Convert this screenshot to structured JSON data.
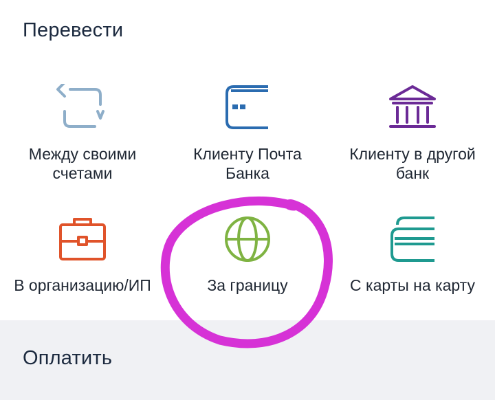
{
  "transfer": {
    "title": "Перевести",
    "items": [
      {
        "label": "Между своими\nсчетами",
        "icon": "arrows-cycle-icon",
        "color": "#8eaec9"
      },
      {
        "label": "Клиенту Почта\nБанка",
        "icon": "card-icon",
        "color": "#2b6cb0"
      },
      {
        "label": "Клиенту в другой\nбанк",
        "icon": "bank-building-icon",
        "color": "#6b2a96"
      },
      {
        "label": "В организацию/ИП",
        "icon": "briefcase-icon",
        "color": "#e0532a"
      },
      {
        "label": "За границу",
        "icon": "globe-icon",
        "color": "#7fb342"
      },
      {
        "label": "С карты на карту",
        "icon": "cards-stack-icon",
        "color": "#1f9a90"
      }
    ]
  },
  "pay": {
    "title": "Оплатить"
  },
  "annotation": {
    "circle_color": "#d632d6"
  }
}
